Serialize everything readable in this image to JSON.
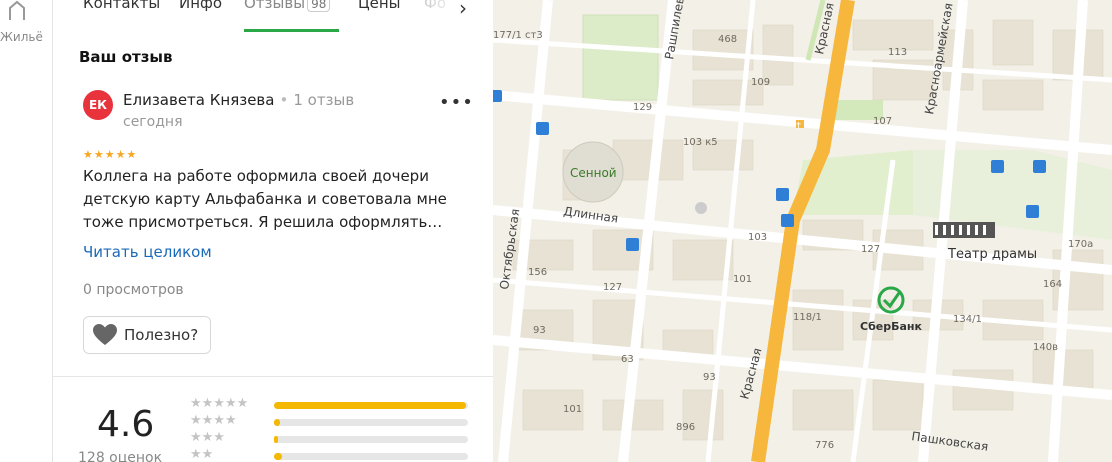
{
  "left_rail": {
    "label": "Жильё"
  },
  "tabs": [
    {
      "label": "Контакты"
    },
    {
      "label": "Инфо"
    },
    {
      "label": "Отзывы",
      "badge": "98"
    },
    {
      "label": "Цены"
    },
    {
      "label": "Фо"
    }
  ],
  "review_section": {
    "title": "Ваш отзыв",
    "author_initials": "ЕК",
    "author_name": "Елизавета Князева",
    "author_reviews": "1 отзыв",
    "date": "сегодня",
    "rating": 5,
    "text": "Коллега на работе оформила своей дочери детскую карту Альфабанка и советовала мне тоже присмотреться. Я решила оформлять…",
    "read_more": "Читать целиком",
    "views": "0 просмотров",
    "useful_label": "Полезно?"
  },
  "summary": {
    "rating": "4.6",
    "count_label": "128 оценок",
    "distribution": [
      {
        "stars": 5,
        "fraction": 0.99
      },
      {
        "stars": 4,
        "fraction": 0.03
      },
      {
        "stars": 3,
        "fraction": 0.02
      },
      {
        "stars": 2,
        "fraction": 0.04
      }
    ]
  },
  "map": {
    "colors": {
      "main_road": "#f6b73c",
      "street": "#ffffff",
      "block": "#e9e4d6",
      "park": "#d9ecc4",
      "brand_green": "#2aa746",
      "bus": "#2f7fd6"
    },
    "pois": [
      {
        "name": "Сенной",
        "type": "market"
      },
      {
        "name": "Театр драмы",
        "type": "theatre"
      },
      {
        "name": "СберБанк",
        "type": "bank"
      }
    ],
    "streets": [
      "Красная",
      "Рашпилевская",
      "Длинная",
      "Октябрьская",
      "Красноармейская",
      "Пашковская"
    ],
    "house_numbers": [
      "177/1 ст3",
      "468",
      "109",
      "113",
      "129",
      "103 к5",
      "107",
      "103",
      "127",
      "170а",
      "156",
      "127",
      "101",
      "164",
      "118/1",
      "134/1",
      "63",
      "93",
      "140в",
      "896",
      "776",
      "101",
      "93"
    ]
  }
}
